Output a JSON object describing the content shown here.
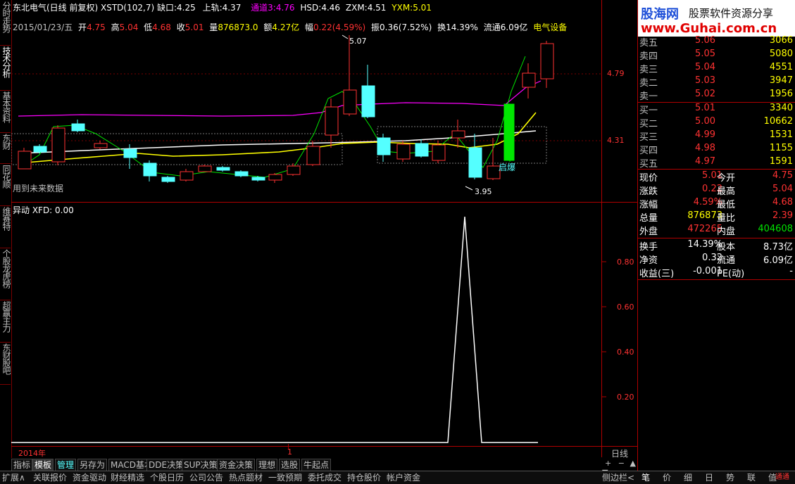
{
  "left_tabs": [
    "分时走势",
    "技术分析",
    "基本资料",
    "东财10",
    "同花顺10",
    "维赛特10",
    "个股龙虎榜",
    "超赢主力",
    "东财股吧"
  ],
  "header": {
    "title": "东北电气(日线 前复权)",
    "xstd": "XSTD(102,7)",
    "gap_low_label": "缺口:",
    "gap_low_value": "4.25",
    "upper_label": "上轨:",
    "upper_value": "4.37",
    "channel_label": "通道3:",
    "channel_value": "4.76",
    "hsd_label": "HSD:",
    "hsd_value": "4.46",
    "zxm_label": "ZXM:",
    "zxm_value": "4.51",
    "yxm_label": "YXM:",
    "yxm_value": "5.01"
  },
  "day_info": {
    "date": "2015/01/23/五",
    "open_label": "开",
    "open": "4.75",
    "high_label": "高",
    "high": "5.04",
    "low_label": "低",
    "low": "4.68",
    "close_label": "收",
    "close": "5.01",
    "vol_label": "量",
    "vol": "876873.0",
    "amount_label": "额",
    "amount": "4.27亿",
    "range_label": "幅",
    "range": "0.22(4.59%)",
    "amp_label": "振",
    "amp": "0.36(7.52%)",
    "turnover_label": "换",
    "turnover": "14.39%",
    "float_label": "流通",
    "float": "6.09亿",
    "sector": "电气设备"
  },
  "kline": {
    "price_ticks": [
      "4.79",
      "4.31"
    ],
    "peak_label": "5.07",
    "trough_label": "3.95",
    "qibao_label": "启爆",
    "future_note": "用到未来数据"
  },
  "indicator": {
    "title": "异动 XFD: 0.00",
    "ticks": [
      "0.80",
      "0.60",
      "0.40",
      "0.20"
    ]
  },
  "time_axis": {
    "year": "2014年",
    "month": "1",
    "period": "日线"
  },
  "bottom_tabs": [
    "指标",
    "模板",
    "管理",
    "另存为",
    "MACD基本",
    "DDE决策",
    "SUP决策",
    "资金决策",
    "理想",
    "选股",
    "牛起点"
  ],
  "status_items": [
    "扩展∧",
    "关联报价",
    "资金驱动",
    "财经精选",
    "个股日历",
    "公司公告",
    "热点题材",
    "一致预期",
    "委托成交",
    "持仓股价",
    "帐户资金"
  ],
  "status_right": "侧边栏<",
  "logo": {
    "title": "股海网",
    "subtitle": "股票软件资源分享",
    "url": "www.Guhai.com.cn"
  },
  "order_book": {
    "asks": [
      {
        "label": "卖五",
        "price": "5.06",
        "vol": "3066"
      },
      {
        "label": "卖四",
        "price": "5.05",
        "vol": "5080"
      },
      {
        "label": "卖三",
        "price": "5.04",
        "vol": "4551"
      },
      {
        "label": "卖二",
        "price": "5.03",
        "vol": "3947"
      },
      {
        "label": "卖一",
        "price": "5.02",
        "vol": "1956"
      }
    ],
    "bids": [
      {
        "label": "买一",
        "price": "5.01",
        "vol": "3340"
      },
      {
        "label": "买二",
        "price": "5.00",
        "vol": "10662"
      },
      {
        "label": "买三",
        "price": "4.99",
        "vol": "1531"
      },
      {
        "label": "买四",
        "price": "4.98",
        "vol": "1155"
      },
      {
        "label": "买五",
        "price": "4.97",
        "vol": "1591"
      }
    ]
  },
  "stats": [
    {
      "l1": "现价",
      "v1": "5.01",
      "c1": "red",
      "l2": "今开",
      "v2": "4.75",
      "c2": "red"
    },
    {
      "l1": "涨跌",
      "v1": "0.22",
      "c1": "red",
      "l2": "最高",
      "v2": "5.04",
      "c2": "red"
    },
    {
      "l1": "涨幅",
      "v1": "4.59%",
      "c1": "red",
      "l2": "最低",
      "v2": "4.68",
      "c2": "red"
    },
    {
      "l1": "总量",
      "v1": "876873",
      "c1": "yellow",
      "l2": "量比",
      "v2": "2.39",
      "c2": "red"
    },
    {
      "l1": "外盘",
      "v1": "472265",
      "c1": "red",
      "l2": "内盘",
      "v2": "404608",
      "c2": "green"
    }
  ],
  "stats2": [
    {
      "l1": "换手",
      "v1": "14.39%",
      "l2": "股本",
      "v2": "8.73亿"
    },
    {
      "l1": "净资",
      "v1": "0.32",
      "l2": "流通",
      "v2": "6.09亿"
    },
    {
      "l1": "收益(三)",
      "v1": "-0.001",
      "l2": "PE(动)",
      "v2": "-"
    }
  ],
  "right_tabs": [
    "笔",
    "价",
    "细",
    "日",
    "势",
    "联",
    "值"
  ],
  "right_corner": "通通",
  "colors": {
    "frame": "#b00000",
    "up": "#ff3232",
    "down": "#54ffff",
    "qibao": "#00e600",
    "ma_white": "#ffffff",
    "ma_yellow": "#ffff00",
    "ma_magenta": "#ff00ff"
  }
}
